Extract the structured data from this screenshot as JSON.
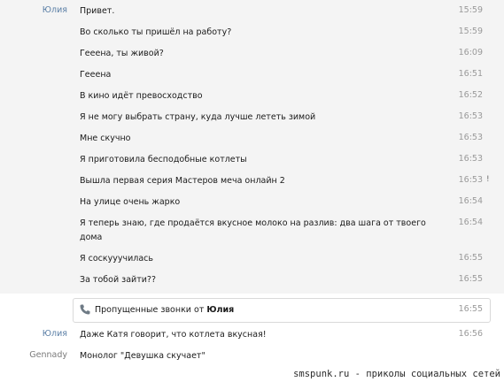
{
  "sender_julia": "Юлия",
  "sender_gennady": "Gennady",
  "messages": [
    {
      "text": "Привет.",
      "time": "15:59"
    },
    {
      "text": "Во сколько ты пришёл на работу?",
      "time": "15:59"
    },
    {
      "text": "Гееена, ты живой?",
      "time": "16:09"
    },
    {
      "text": "Гееена",
      "time": "16:51"
    },
    {
      "text": "В кино идёт превосходство",
      "time": "16:52"
    },
    {
      "text": "Я не могу выбрать страну, куда лучше лететь зимой",
      "time": "16:53"
    },
    {
      "text": "Мне скучно",
      "time": "16:53"
    },
    {
      "text": "Я приготовила бесподобные котлеты",
      "time": "16:53"
    },
    {
      "text": "Вышла первая серия Мастеров меча онлайн 2",
      "time": "16:53",
      "status": "!"
    },
    {
      "text": "На улице очень жарко",
      "time": "16:54"
    },
    {
      "text": "Я теперь знаю, где продаётся вкусное молоко на разлив: два шага от твоего дома",
      "time": "16:54"
    },
    {
      "text": "Я соскууучилась",
      "time": "16:55"
    },
    {
      "text": "За тобой зайти??",
      "time": "16:55"
    }
  ],
  "missed_call": {
    "icon": "phone-icon",
    "text": "Пропущенные звонки от ",
    "name": "Юлия",
    "time": "16:55"
  },
  "after_call": {
    "text": "Даже Катя говорит, что котлета вкусная!",
    "time": "16:56"
  },
  "gennady_message": {
    "text": "Монолог \"Девушка скучает\""
  },
  "watermark": "smspunk.ru - приколы социальных сетей"
}
